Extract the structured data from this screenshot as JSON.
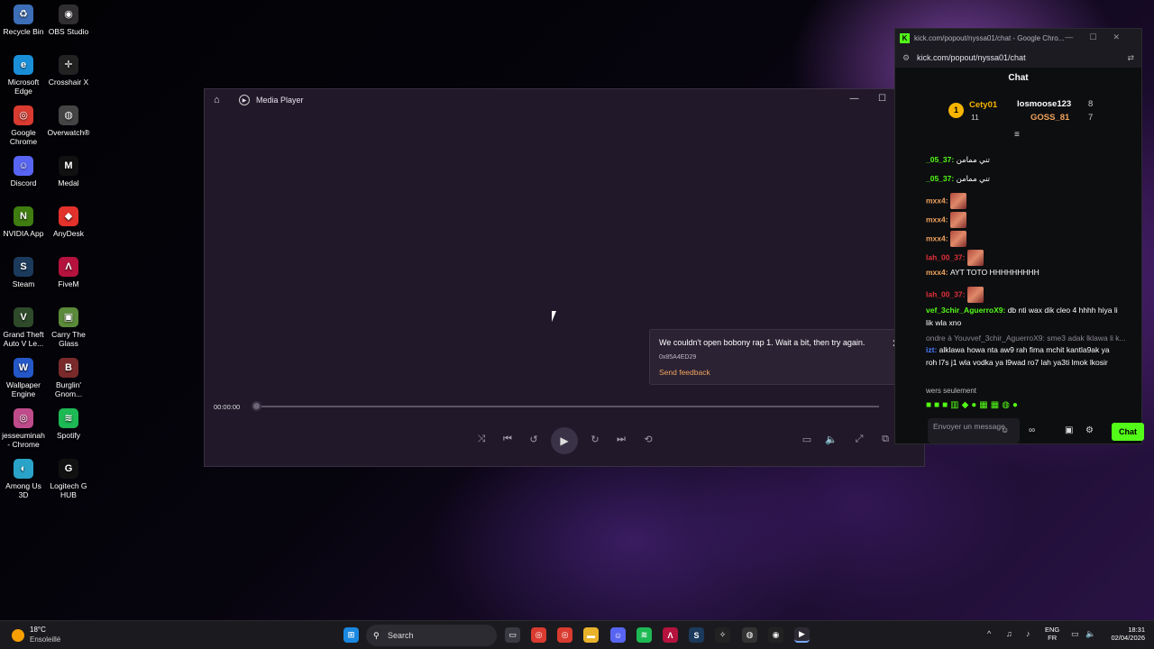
{
  "desktop": {
    "icons": [
      {
        "label": "Recycle Bin",
        "icon": "recycle-bin-icon",
        "color": "#3d6fb8",
        "glyph": "♻"
      },
      {
        "label": "OBS Studio",
        "icon": "obs-icon",
        "color": "#302e31",
        "glyph": "◉"
      },
      {
        "label": "Microsoft Edge",
        "icon": "edge-icon",
        "color": "#1a8fd8",
        "glyph": "e"
      },
      {
        "label": "Crosshair X",
        "icon": "crosshair-icon",
        "color": "#222222",
        "glyph": "✛"
      },
      {
        "label": "Google Chrome",
        "icon": "chrome-icon",
        "color": "#d93b30",
        "glyph": "◎"
      },
      {
        "label": "Overwatch®",
        "icon": "overwatch-icon",
        "color": "#444444",
        "glyph": "◍"
      },
      {
        "label": "Discord",
        "icon": "discord-icon",
        "color": "#5865f2",
        "glyph": "☺"
      },
      {
        "label": "Medal",
        "icon": "medal-icon",
        "color": "#111111",
        "glyph": "M"
      },
      {
        "label": "NVIDIA App",
        "icon": "nvidia-icon",
        "color": "#3f7d10",
        "glyph": "N"
      },
      {
        "label": "AnyDesk",
        "icon": "anydesk-icon",
        "color": "#e3322b",
        "glyph": "◆"
      },
      {
        "label": "Steam",
        "icon": "steam-icon",
        "color": "#1b3a5c",
        "glyph": "S"
      },
      {
        "label": "FiveM",
        "icon": "fivem-icon",
        "color": "#b5123e",
        "glyph": "Λ"
      },
      {
        "label": "Grand Theft Auto V Le...",
        "icon": "gta-icon",
        "color": "#2e4a2a",
        "glyph": "V"
      },
      {
        "label": "Carry The Glass",
        "icon": "carry-glass-icon",
        "color": "#5a8a3a",
        "glyph": "▣"
      },
      {
        "label": "Wallpaper Engine",
        "icon": "wallpaper-engine-icon",
        "color": "#2458c8",
        "glyph": "W"
      },
      {
        "label": "Burglin' Gnom...",
        "icon": "burglin-gnomes-icon",
        "color": "#7a2a2a",
        "glyph": "B"
      },
      {
        "label": "jesseuminah - Chrome",
        "icon": "chrome-profile-icon",
        "color": "#c04b8a",
        "glyph": "◎"
      },
      {
        "label": "Spotify",
        "icon": "spotify-icon",
        "color": "#1db954",
        "glyph": "≋"
      },
      {
        "label": "Among Us 3D",
        "icon": "among-us-icon",
        "color": "#2aa3c9",
        "glyph": "◐"
      },
      {
        "label": "Logitech G HUB",
        "icon": "logitech-icon",
        "color": "#111111",
        "glyph": "G"
      }
    ]
  },
  "media_player": {
    "title": "Media Player",
    "window_controls": [
      "—",
      "☐",
      "✕"
    ],
    "error": {
      "message": "We couldn't open bobony rap 1. Wait a bit, then try again.",
      "code": "0x85A4ED29",
      "feedback": "Send feedback",
      "close": "✕"
    },
    "time": "00:00:00",
    "progress": 0,
    "controls": {
      "shuffle": "⤨",
      "previous": "⏮",
      "rewind": "↺",
      "play": "▶",
      "forward": "↻",
      "next": "⏭",
      "repeat": "⟲",
      "miniplayer": "▭",
      "volume": "🔈",
      "fullscreen": "⤢",
      "cast": "⧉",
      "more": "⋯"
    }
  },
  "chrome_chat": {
    "tab_title": "kick.com/popout/nyssa01/chat - Google Chro...",
    "window_controls": [
      "—",
      "☐",
      "✕"
    ],
    "url": "kick.com/popout/nyssa01/chat",
    "heading": "Chat",
    "leaderboard": {
      "first": {
        "rank": "1",
        "name": "Cety01",
        "count": "11"
      },
      "others": [
        {
          "name": "losmoose123",
          "count": "8"
        },
        {
          "name": "GOSS_81",
          "count": "7"
        }
      ]
    },
    "messages": [
      {
        "user": "_05_37:",
        "text": "تني ممامن",
        "color": "#53fc18"
      },
      {
        "user": "_05_37:",
        "text": "تني ممامن",
        "color": "#53fc18"
      },
      {
        "user": "mxx4:",
        "text": "",
        "color": "#f0a35e"
      },
      {
        "user": "mxx4:",
        "text": "",
        "color": "#f0a35e"
      },
      {
        "user": "mxx4:",
        "text": "",
        "color": "#f0a35e"
      },
      {
        "user": "lah_00_37:",
        "text": "",
        "color": "#e0303a"
      },
      {
        "user": "mxx4:",
        "text": "AYT TOTO HHHHHHHHH",
        "color": "#f0a35e"
      },
      {
        "user": "lah_00_37:",
        "text": "",
        "color": "#e0303a"
      },
      {
        "user": "vef_3chir_AguerroX9:",
        "text": "db nti wax dik cleo 4 hhhh hiya li",
        "color": "#53fc18"
      },
      {
        "user": "",
        "text": "lik wla xno",
        "color": "#53fc18"
      },
      {
        "user": "",
        "text": "ondre à Youvvef_3chir_AguerroX9: sme3 adak lklawa li k...",
        "color": "#8b8794"
      },
      {
        "user": "izt:",
        "text": "alklawa howa nta aw9 rah fima mchit kantla9ak ya",
        "color": "#4a7bff"
      },
      {
        "user": "",
        "text": "roh l7s j1 wla vodka ya l9wad ro7 lah ya3ti lmok lkosir",
        "color": "#4a7bff"
      }
    ],
    "followers_only": "wers seulement",
    "input_placeholder": "Envoyer un message",
    "send_label": "Chat"
  },
  "taskbar": {
    "weather_temp": "18°C",
    "weather_desc": "Ensoleillé",
    "search_label": "Search",
    "language": "ENG",
    "layout": "FR",
    "time": "18:31",
    "date": "02/04/2026"
  }
}
